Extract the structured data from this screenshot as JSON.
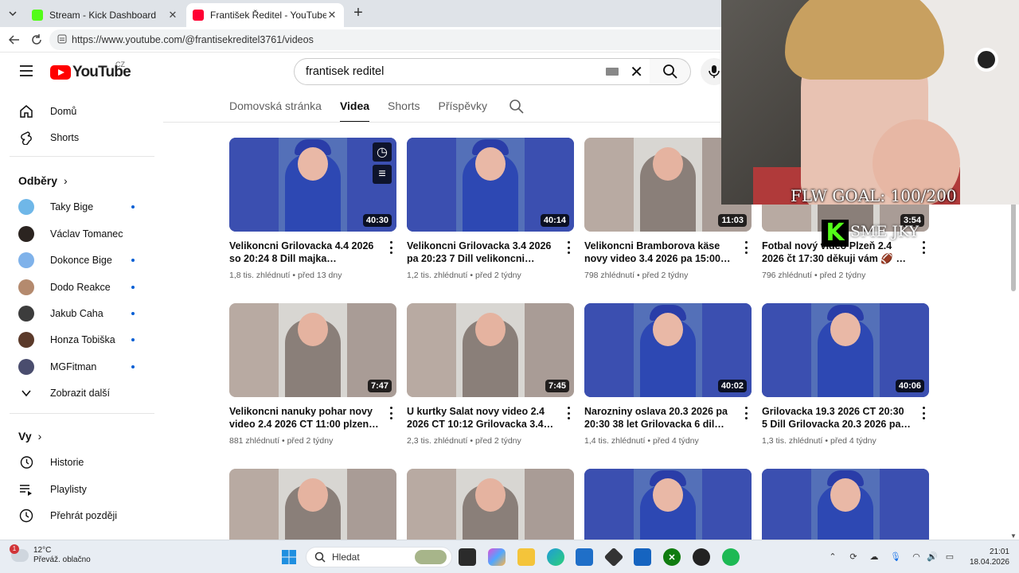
{
  "browser": {
    "tabs": [
      {
        "title": "Stream - Kick Dashboard",
        "favicon_color": "#53fc18",
        "active": false
      },
      {
        "title": "František Ředitel - YouTube",
        "favicon_color": "#ff0033",
        "active": true
      }
    ],
    "url": "https://www.youtube.com/@frantisekreditel3761/videos"
  },
  "youtube": {
    "logo_text": "YouTube",
    "country_code": "CZ",
    "search_query": "frantisek reditel"
  },
  "sidebar": {
    "main": [
      {
        "label": "Domů",
        "icon": "home-icon"
      },
      {
        "label": "Shorts",
        "icon": "shorts-icon"
      }
    ],
    "subscriptions_heading": "Odběry",
    "subscriptions": [
      {
        "label": "Taky Bige",
        "avatar_color": "#6fb7e8",
        "new": true
      },
      {
        "label": "Václav Tomanec",
        "avatar_color": "#2b2420",
        "new": false
      },
      {
        "label": "Dokonce Bige",
        "avatar_color": "#7fb2ea",
        "new": true
      },
      {
        "label": "Dodo Reakce",
        "avatar_color": "#b48a6e",
        "new": true
      },
      {
        "label": "Jakub Caha",
        "avatar_color": "#3c3c3c",
        "new": true
      },
      {
        "label": "Honza Tobiška",
        "avatar_color": "#5b3a2a",
        "new": true
      },
      {
        "label": "MGFitman",
        "avatar_color": "#4a4d6e",
        "new": true
      }
    ],
    "show_more": "Zobrazit další",
    "you_heading": "Vy",
    "you_items": [
      {
        "label": "Historie",
        "icon": "history-icon"
      },
      {
        "label": "Playlisty",
        "icon": "playlist-icon"
      },
      {
        "label": "Přehrát později",
        "icon": "watch-later-icon"
      }
    ]
  },
  "channel_tabs": {
    "items": [
      "Domovská stránka",
      "Videa",
      "Shorts",
      "Příspěvky"
    ],
    "active": "Videa"
  },
  "videos": [
    {
      "title": "Velikoncni Grilovacka 4.4 2026 so 20:24 8 Dill majka Grilovacka 30.4-...",
      "views": "1,8 tis. zhlédnutí",
      "age": "před 13 dny",
      "duration": "40:30",
      "style": "blue"
    },
    {
      "title": "Velikoncni Grilovacka 3.4 2026 pa 20:23 7 Dill velikoncni Grilovacka...",
      "views": "1,2 tis. zhlédnutí",
      "age": "před 2 týdny",
      "duration": "40:14",
      "style": "blue"
    },
    {
      "title": "Velikoncni Bramborova käse novy video 3.4 2026 pa 15:00 plzen...",
      "views": "798 zhlédnutí",
      "age": "před 2 týdny",
      "duration": "11:03",
      "style": "plain"
    },
    {
      "title": "Fotbal nový video Plzeň 2.4 2026 čt 17:30 děkuji vám 🏈 🏈 🏈 🏈 🏈 ...",
      "views": "796 zhlédnutí",
      "age": "před 2 týdny",
      "duration": "3:54",
      "style": "plain"
    },
    {
      "title": "Velikoncni nanuky pohar novy video 2.4 2026 CT 11:00 plzen dekuji va...",
      "views": "881 zhlédnutí",
      "age": "před 2 týdny",
      "duration": "7:47",
      "style": "plain"
    },
    {
      "title": "U kurtky Salat novy video 2.4 2026 CT 10:12 Grilovacka 3.4-4.4 2026...",
      "views": "2,3 tis. zhlédnutí",
      "age": "před 2 týdny",
      "duration": "7:45",
      "style": "plain"
    },
    {
      "title": "Narozniny oslava 20.3 2026 pa 20:30 38 let Grilovacka 6 dil plzen...",
      "views": "1,4 tis. zhlédnutí",
      "age": "před 4 týdny",
      "duration": "40:02",
      "style": "blue"
    },
    {
      "title": "Grilovacka 19.3 2026 CT 20:30 5 Dill Grilovacka 20.3 2026 pa 19:40-2:0...",
      "views": "1,3 tis. zhlédnutí",
      "age": "před 4 týdny",
      "duration": "40:06",
      "style": "blue"
    },
    {
      "title": "",
      "views": "",
      "age": "",
      "duration": "",
      "style": "plain"
    },
    {
      "title": "",
      "views": "",
      "age": "",
      "duration": "",
      "style": "plain"
    },
    {
      "title": "",
      "views": "",
      "age": "",
      "duration": "",
      "style": "blue"
    },
    {
      "title": "",
      "views": "",
      "age": "",
      "duration": "",
      "style": "blue"
    }
  ],
  "overlay": {
    "goal_text": "FLW GOAL: 100/200",
    "kick_letter": "K",
    "sub_text": "SME JKY"
  },
  "taskbar": {
    "weather_temp": "12°C",
    "weather_desc": "Převáž. oblačno",
    "weather_badge": "1",
    "search_placeholder": "Hledat",
    "time": "21:01",
    "date": "18.04.2026"
  }
}
